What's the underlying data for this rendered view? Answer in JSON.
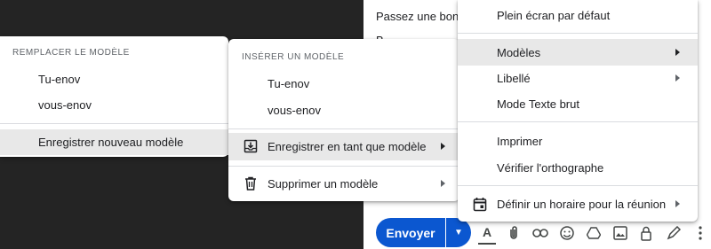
{
  "compose": {
    "body_line1": "Passez une bonn",
    "body_line2": "B"
  },
  "toolbar": {
    "send_label": "Envoyer",
    "icons": [
      "format-text-icon",
      "attach-icon",
      "link-icon",
      "emoji-icon",
      "drive-icon",
      "photo-icon",
      "lock-clock-icon",
      "signature-icon",
      "more-icon"
    ]
  },
  "menu_replace": {
    "header": "REMPLACER LE MODÈLE",
    "items": [
      "Tu-enov",
      "vous-enov",
      "Enregistrer nouveau modèle"
    ]
  },
  "menu_insert": {
    "header": "INSÉRER UN MODÈLE",
    "items": [
      "Tu-enov",
      "vous-enov",
      "Enregistrer en tant que modèle",
      "Supprimer un modèle"
    ]
  },
  "menu_more": {
    "items": [
      "Plein écran par défaut",
      "Modèles",
      "Libellé",
      "Mode Texte brut",
      "Imprimer",
      "Vérifier l'orthographe",
      "Définir un horaire pour la réunion"
    ]
  }
}
